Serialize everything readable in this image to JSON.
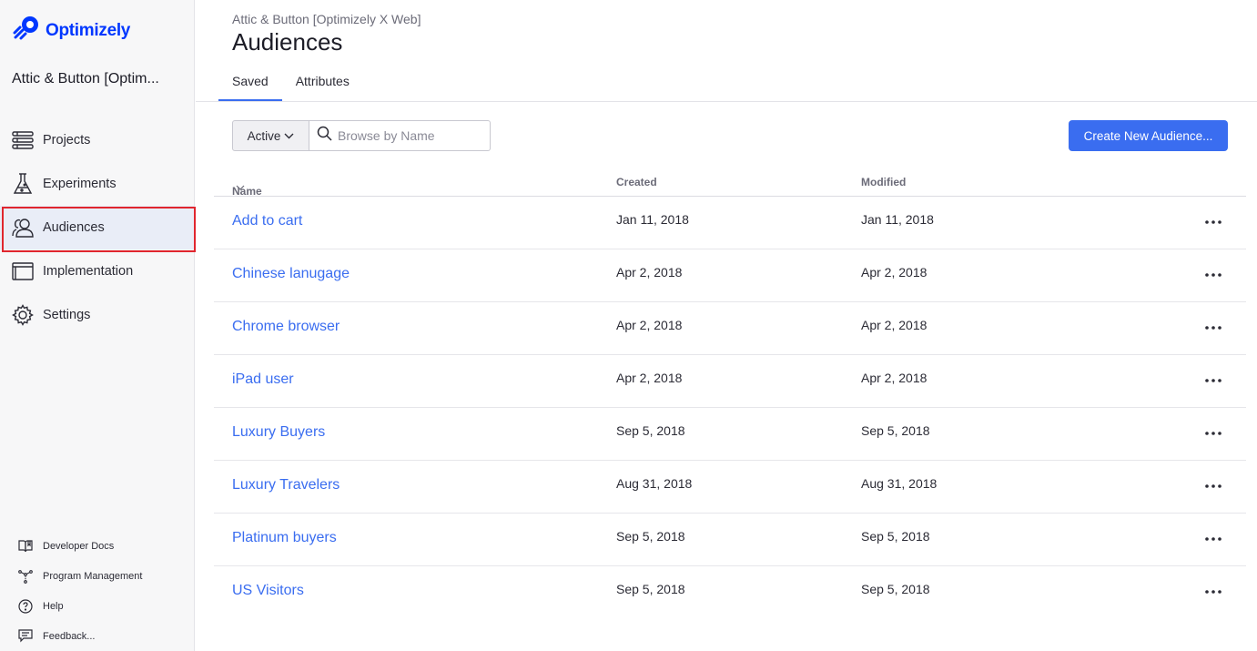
{
  "brand": {
    "name": "Optimizely",
    "color": "#0037ff"
  },
  "sidebar": {
    "project_name": "Attic & Button [Optim...",
    "items": [
      {
        "label": "Projects",
        "icon": "projects-icon"
      },
      {
        "label": "Experiments",
        "icon": "flask-icon"
      },
      {
        "label": "Audiences",
        "icon": "audiences-icon",
        "active": true
      },
      {
        "label": "Implementation",
        "icon": "window-icon"
      },
      {
        "label": "Settings",
        "icon": "gear-icon"
      }
    ],
    "footer": [
      {
        "label": "Developer Docs",
        "icon": "book-icon"
      },
      {
        "label": "Program Management",
        "icon": "network-icon"
      },
      {
        "label": "Help",
        "icon": "help-icon"
      },
      {
        "label": "Feedback...",
        "icon": "feedback-icon"
      }
    ]
  },
  "header": {
    "breadcrumb": "Attic & Button [Optimizely X Web]",
    "title": "Audiences"
  },
  "tabs": [
    {
      "label": "Saved",
      "active": true
    },
    {
      "label": "Attributes",
      "active": false
    }
  ],
  "filter": {
    "status_value": "Active",
    "search_placeholder": "Browse by Name"
  },
  "create_button": "Create New Audience...",
  "table": {
    "columns": [
      "Name",
      "Created",
      "Modified"
    ],
    "rows": [
      {
        "name": "Add to cart",
        "created": "Jan 11, 2018",
        "modified": "Jan 11, 2018"
      },
      {
        "name": "Chinese lanugage",
        "created": "Apr 2, 2018",
        "modified": "Apr 2, 2018"
      },
      {
        "name": "Chrome browser",
        "created": "Apr 2, 2018",
        "modified": "Apr 2, 2018"
      },
      {
        "name": "iPad user",
        "created": "Apr 2, 2018",
        "modified": "Apr 2, 2018"
      },
      {
        "name": "Luxury Buyers",
        "created": "Sep 5, 2018",
        "modified": "Sep 5, 2018"
      },
      {
        "name": "Luxury Travelers",
        "created": "Aug 31, 2018",
        "modified": "Aug 31, 2018"
      },
      {
        "name": "Platinum buyers",
        "created": "Sep 5, 2018",
        "modified": "Sep 5, 2018"
      },
      {
        "name": "US Visitors",
        "created": "Sep 5, 2018",
        "modified": "Sep 5, 2018"
      }
    ]
  },
  "colors": {
    "accent": "#3a6df0",
    "active_highlight": "#e0262e"
  }
}
